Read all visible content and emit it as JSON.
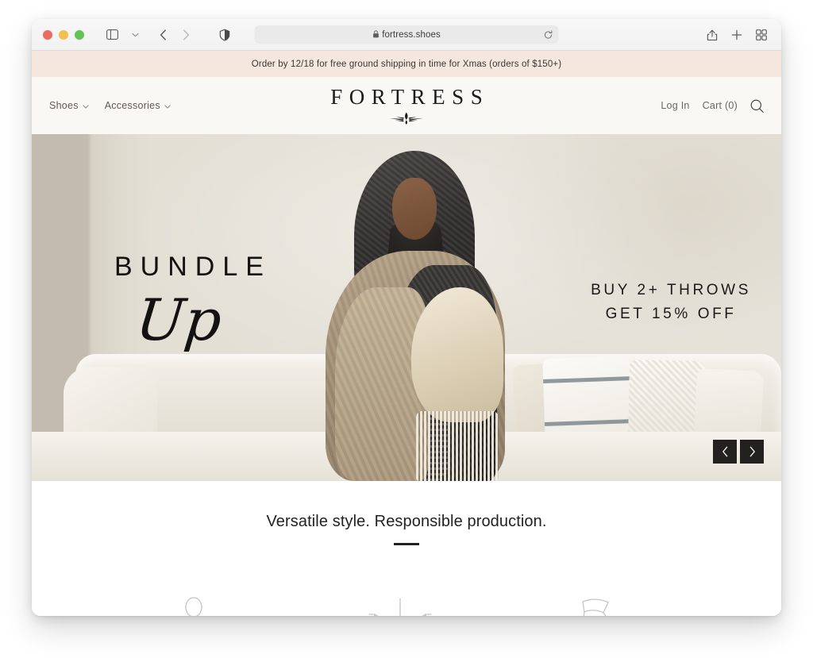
{
  "browser": {
    "traffic_lights": [
      "close",
      "minimize",
      "zoom"
    ],
    "sidebar_icon": "sidebar-icon",
    "sidebar_chevron_icon": "chevron-down-icon",
    "back_icon": "chevron-left-icon",
    "forward_icon": "chevron-right-icon",
    "shield_icon": "privacy-shield-icon",
    "lock_icon": "lock-icon",
    "url": "fortress.shoes",
    "reload_icon": "reload-icon",
    "share_icon": "share-icon",
    "new_tab_icon": "plus-icon",
    "tab_overview_icon": "tab-grid-icon"
  },
  "site": {
    "announcement": "Order by 12/18 for free ground shipping in time for Xmas (orders of $150+)",
    "announcement_bg": "#f6e7de",
    "header_bg": "#faf8f4",
    "nav_left": [
      {
        "label": "Shoes",
        "has_caret": true
      },
      {
        "label": "Accessories",
        "has_caret": true
      }
    ],
    "brand": {
      "name": "FORTRESS",
      "mark_icon": "winged-emblem-icon"
    },
    "nav_right": [
      {
        "label": "Log In",
        "has_caret": false
      },
      {
        "label": "Cart (0)",
        "has_caret": false
      }
    ],
    "search_icon": "search-icon"
  },
  "hero": {
    "headline_top": "BUNDLE",
    "headline_script": "Up",
    "offer_line1": "BUY 2+ THROWS",
    "offer_line2": "GET 15% OFF",
    "prev_icon": "chevron-left-icon",
    "next_icon": "chevron-right-icon",
    "alt": "Model wrapped in layered knit throws on a cream sofa"
  },
  "value_props": {
    "title": "Versatile style. Responsible production.",
    "icons": [
      {
        "name": "seated-figure-icon"
      },
      {
        "name": "balance-scale-icon"
      },
      {
        "name": "shoe-icon"
      }
    ]
  }
}
